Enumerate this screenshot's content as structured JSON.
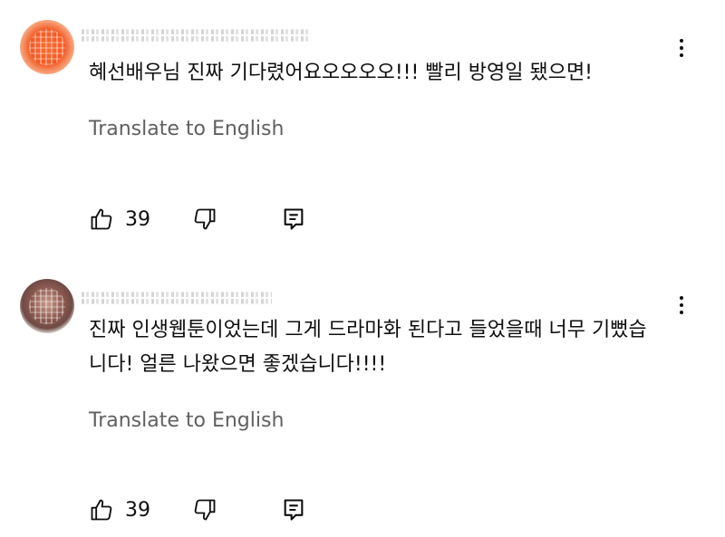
{
  "comments": [
    {
      "text": "혜선배우님 진짜 기다렸어요오오오오!!! 빨리 방영일 됐으면!",
      "translate_label": "Translate to English",
      "likes": "39",
      "avatar_color": "#f25a24"
    },
    {
      "text": "진짜 인생웹툰이었는데 그게 드라마화 된다고 들었을때 너무 기뻤습\n니다! 얼른 나왔으면 좋겠습니다!!!!",
      "translate_label": "Translate to English",
      "likes": "39",
      "avatar_color": "#8d5a4f"
    }
  ],
  "icons": {
    "like": "thumbs-up-icon",
    "dislike": "thumbs-down-icon",
    "reply": "reply-icon",
    "more": "more-vertical-icon"
  }
}
